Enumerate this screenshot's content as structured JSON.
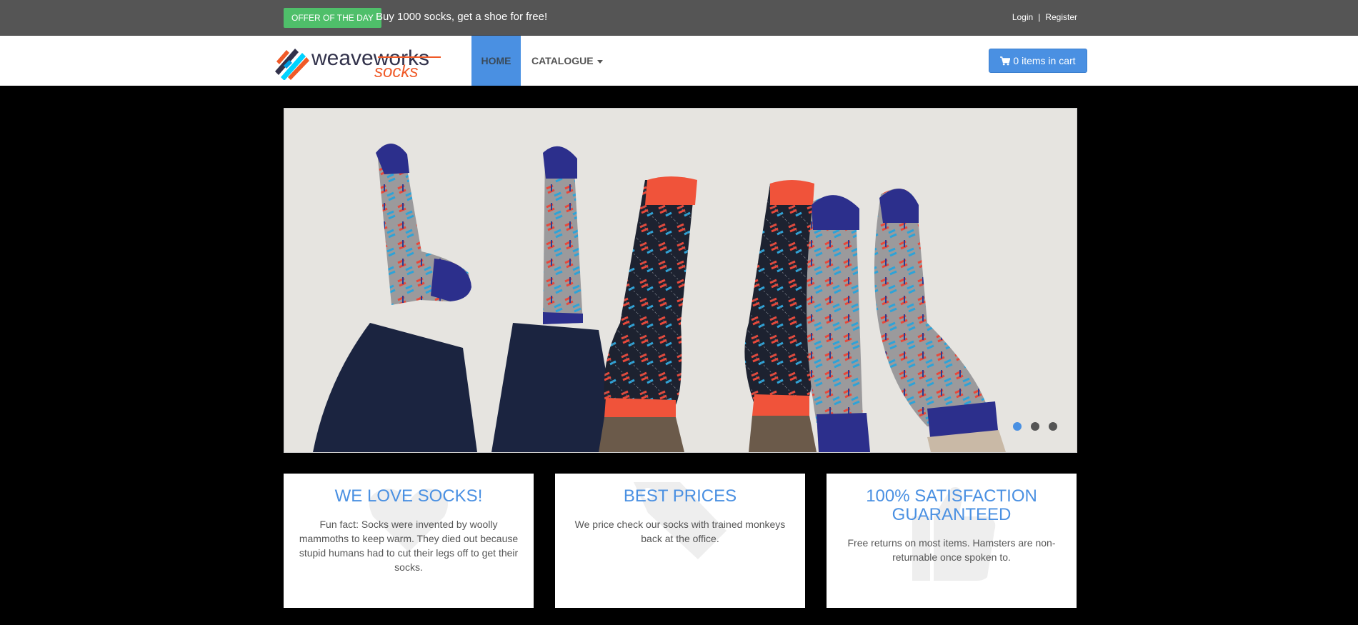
{
  "topbar": {
    "offer_badge": "OFFER OF THE DAY",
    "offer_text": "Buy 1000 socks, get a shoe for free!",
    "login": "Login",
    "separator": "|",
    "register": "Register"
  },
  "logo": {
    "word_main": "weaveworks",
    "word_sub": "socks"
  },
  "nav": {
    "home": "HOME",
    "catalogue": "CATALOGUE"
  },
  "cart": {
    "label": "0 items in cart",
    "icon": "cart-icon"
  },
  "carousel": {
    "slides": 3,
    "active_index": 0
  },
  "features": [
    {
      "title": "WE LOVE SOCKS!",
      "text": "Fun fact: Socks were invented by woolly mammoths to keep warm. They died out because stupid humans had to cut their legs off to get their socks.",
      "icon": "heart-icon"
    },
    {
      "title": "BEST PRICES",
      "text": "We price check our socks with trained monkeys back at the office.",
      "icon": "tag-icon"
    },
    {
      "title": "100% SATISFACTION GUARANTEED",
      "text": "Free returns on most items. Hamsters are non-returnable once spoken to.",
      "icon": "thumbs-up-icon"
    }
  ],
  "colors": {
    "topbar_bg": "#555555",
    "offer_green": "#4fbf6a",
    "accent_blue": "#4a90e2",
    "logo_orange": "#f05a28"
  }
}
